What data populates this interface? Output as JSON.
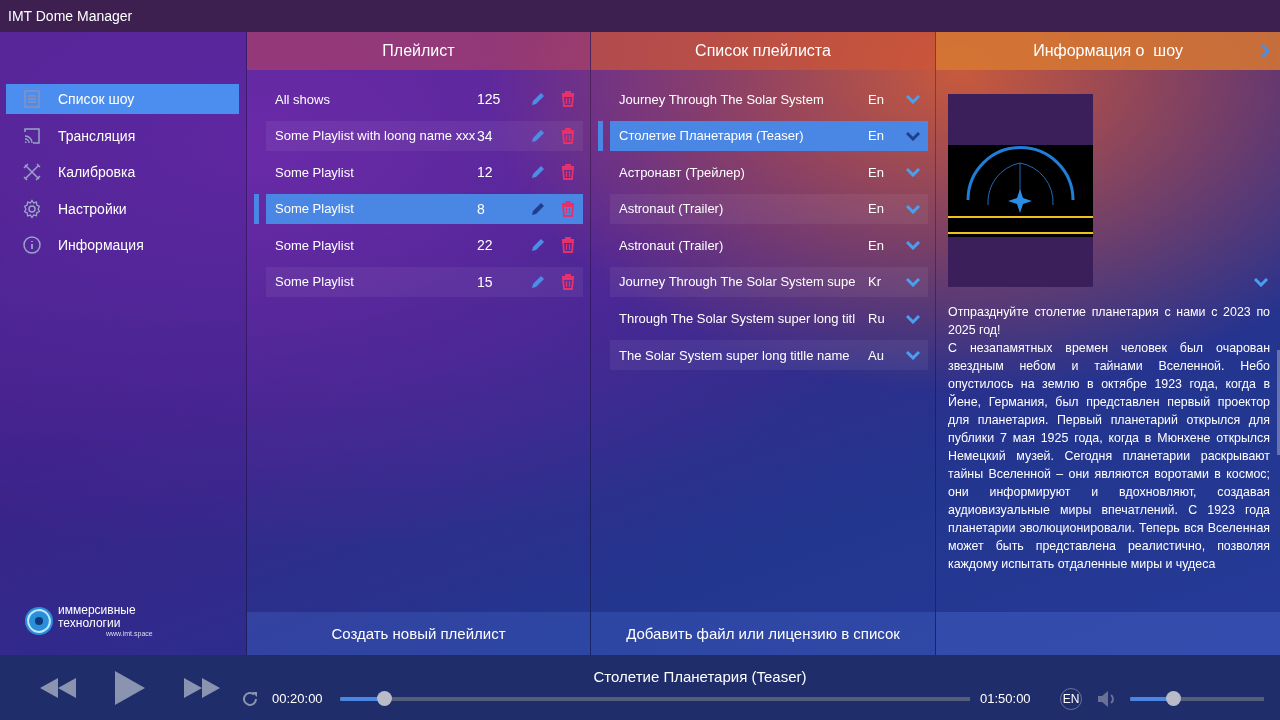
{
  "window": {
    "title": "IMT Dome Manager"
  },
  "sidebar": {
    "items": [
      {
        "label": "Список шоу",
        "kind": "list",
        "selected": true
      },
      {
        "label": "Трансляция",
        "kind": "cast",
        "selected": false
      },
      {
        "label": "Калибровка",
        "kind": "tools",
        "selected": false
      },
      {
        "label": "Настройки",
        "kind": "gear",
        "selected": false
      },
      {
        "label": "Информация",
        "kind": "info",
        "selected": false
      }
    ],
    "logo": {
      "line_1": "иммерсивные",
      "line_2": "технологии",
      "url": "www.imt.space"
    }
  },
  "playlists": {
    "header": "Плейлист",
    "items": [
      {
        "name": "All shows",
        "count": "125",
        "selected": false
      },
      {
        "name": "Some Playlist with loong name xxx",
        "count": "34",
        "selected": false
      },
      {
        "name": "Some Playlist",
        "count": "12",
        "selected": false
      },
      {
        "name": "Some Playlist",
        "count": "8",
        "selected": true
      },
      {
        "name": "Some Playlist",
        "count": "22",
        "selected": false
      },
      {
        "name": "Some Playlist",
        "count": "15",
        "selected": false
      }
    ],
    "create_button": "Создать новый плейлист"
  },
  "playlist_content": {
    "header": "Список плейлиста",
    "items": [
      {
        "title": "Journey Through The Solar System",
        "language": "En",
        "selected": false
      },
      {
        "title": "Столетие Планетария (Teaser)",
        "language": "En",
        "selected": true
      },
      {
        "title": "Астронавт (Трейлер)",
        "language": "En",
        "selected": false
      },
      {
        "title": "Astronaut  (Trailer)",
        "language": "En",
        "selected": false
      },
      {
        "title": "Astronaut  (Trailer)",
        "language": "En",
        "selected": false
      },
      {
        "title": "Journey Through The Solar System supe",
        "language": "Kr",
        "selected": false
      },
      {
        "title": "Through The Solar System super long titl",
        "language": "Ru",
        "selected": false
      },
      {
        "title": "The Solar System super long titlle name",
        "language": "Au",
        "selected": false
      }
    ],
    "add_button": "Добавить файл или лицензию в список"
  },
  "show_info": {
    "header": "Информация о  шоу",
    "description": [
      "Отпразднуйте столетие планетария с нами с 2023 по 2025 год!",
      "С незапамятных времен человек был очарован звездным небом и тайнами Вселенной. Небо опустилось на землю в октябре 1923 года, когда в Йене, Германия, был представлен первый проектор для планетария. Первый планетарий открылся для публики 7 мая 1925 года, когда в Мюнхене открылся Немецкий музей. Сегодня планетарии раскрывают тайны Вселенной – они являются воротами в космос; они информируют и вдохновляют, создавая аудиовизуальные миры впечатлений. С 1923 года планетарии эволюционировали. Теперь вся Вселенная может быть представлена реалистично, позволяя каждому испытать отдаленные миры и чудеса"
    ]
  },
  "player": {
    "track_title": "Столетие Планетария (Teaser)",
    "elapsed": "00:20:00",
    "progress": {
      "level": 0.07
    },
    "duration": "01:50:00",
    "language": "EN",
    "volume": {
      "level": 0.32
    }
  }
}
